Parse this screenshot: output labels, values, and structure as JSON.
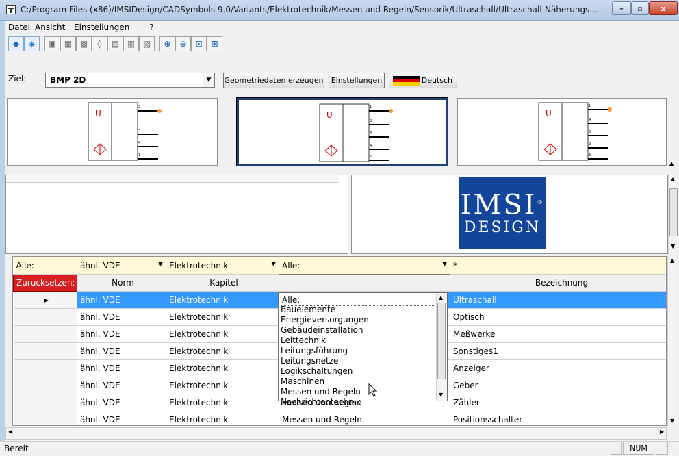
{
  "window": {
    "title": "C:/Program Files (x86)/IMSIDesign/CADSymbols 9.0/Variants/Elektrotechnik/Messen und Regeln/Sensorik/Ultraschall/Ultraschall-Näherungs...",
    "min": "–",
    "max": "▫",
    "close": "x"
  },
  "menu": [
    "Datei",
    "Ansicht",
    "Einstellungen",
    "?"
  ],
  "toolbar": {
    "icons": [
      "view-2d-icon",
      "view-3d-icon",
      "box-front-icon",
      "box-iso-icon",
      "box-shaded-icon",
      "cylinder-icon",
      "box-wire-icon",
      "box-wire2-icon",
      "box-right-icon",
      "zoom-in-icon",
      "zoom-out-icon",
      "zoom-window-icon",
      "zoom-fit-icon"
    ]
  },
  "ziel": {
    "label": "Ziel:",
    "value": "BMP  2D",
    "geometry_button": "Geometriedaten erzeugen",
    "settings_button": "Einstellungen",
    "language_button": "Deutsch",
    "flag_colors": [
      "#000000",
      "#dd0000",
      "#ffce00"
    ]
  },
  "previews": [
    {
      "pins": [
        "2",
        "3",
        "4",
        "1"
      ]
    },
    {
      "pins": [
        "1",
        "2",
        "3",
        "4",
        "2"
      ]
    },
    {
      "pins": [
        "1",
        "4",
        "3",
        "2",
        "3"
      ]
    }
  ],
  "logo": {
    "top": "IMSI",
    "reg": "®",
    "bottom": "DESIGN"
  },
  "grid": {
    "filters": {
      "all": "Alle:",
      "norm": "ähnl. VDE",
      "kapitel": "Elektrotechnik",
      "sub": "Alle:",
      "bez": "*"
    },
    "reset": "Zurucksetzen:",
    "headers": {
      "norm": "Norm",
      "kapitel": "Kapitel",
      "bez": "Bezeichnung"
    },
    "rows": [
      {
        "norm": "ähnl. VDE",
        "kapitel": "Elektrotechnik",
        "sub": "",
        "bez": "Ultraschall"
      },
      {
        "norm": "ähnl. VDE",
        "kapitel": "Elektrotechnik",
        "sub": "",
        "bez": "Optisch"
      },
      {
        "norm": "ähnl. VDE",
        "kapitel": "Elektrotechnik",
        "sub": "",
        "bez": "Meßwerke"
      },
      {
        "norm": "ähnl. VDE",
        "kapitel": "Elektrotechnik",
        "sub": "",
        "bez": "Sonstiges1"
      },
      {
        "norm": "ähnl. VDE",
        "kapitel": "Elektrotechnik",
        "sub": "",
        "bez": "Anzeiger"
      },
      {
        "norm": "ähnl. VDE",
        "kapitel": "Elektrotechnik",
        "sub": "",
        "bez": "Geber"
      },
      {
        "norm": "ähnl. VDE",
        "kapitel": "Elektrotechnik",
        "sub": "Messen und Regeln",
        "bez": "Zähler"
      },
      {
        "norm": "ähnl. VDE",
        "kapitel": "Elektrotechnik",
        "sub": "Messen und Regeln",
        "bez": "Positionsschalter"
      }
    ]
  },
  "dropdown": {
    "items": [
      "Alle:",
      "Bauelemente",
      "Energieversorgungen",
      "Gebäudeinstallation",
      "Leittechnik",
      "Leitungsführung",
      "Leitungsnetze",
      "Logikschaltungen",
      "Maschinen",
      "Messen und Regeln",
      "Nachrichtentechnik"
    ]
  },
  "status": {
    "text": "Bereit",
    "num": "NUM"
  }
}
